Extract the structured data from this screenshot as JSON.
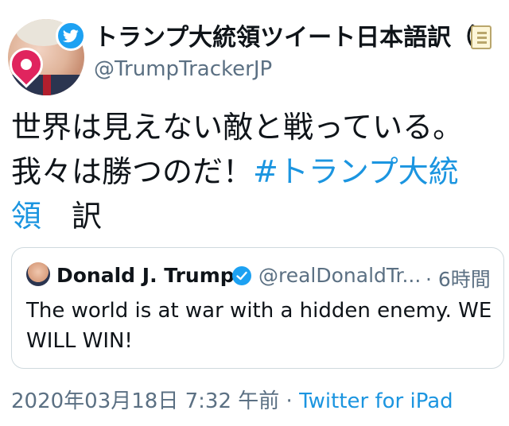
{
  "author": {
    "display_name": "トランプ大統領ツイート日本語訳（",
    "handle": "@TrumpTrackerJP",
    "avatar_icon": "trump-portrait-avatar",
    "badge_icons": [
      "map-pin-icon",
      "twitter-bird-icon",
      "memo-icon"
    ]
  },
  "tweet": {
    "line1": "世界は見えない敵と戦っている。",
    "line2_text": "我々は勝つのだ！",
    "line2_hashtag": "#トランプ大統",
    "line3_hashtag": "領",
    "line3_text": "　訳"
  },
  "quoted": {
    "name": "Donald J. Trump",
    "handle": "@realDonaldTr...",
    "time": "· 6時間",
    "text": "The world is at war with a hidden enemy. WE WILL WIN!",
    "verified_icon": "verified-badge-icon"
  },
  "meta": {
    "timestamp": "2020年03月18日 7:32 午前",
    "separator": " · ",
    "source": "Twitter for iPad"
  },
  "colors": {
    "link": "#1b95e0",
    "secondary_text": "#5b7083",
    "border": "#cfd9de",
    "twitter_blue": "#1da1f2"
  }
}
